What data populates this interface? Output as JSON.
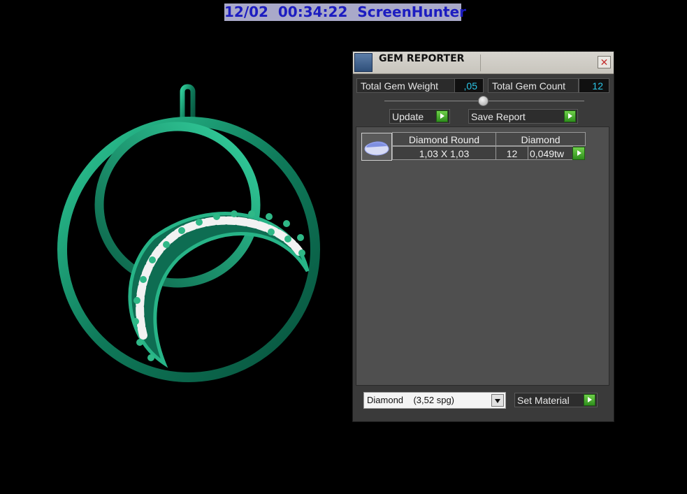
{
  "timestamp_overlay": "12/02  00:34:22  ScreenHunter",
  "viewport": {
    "model_color": "#1a8a68",
    "model_highlight": "#3ad0a2",
    "gem_color": "#f2f2f2"
  },
  "gem_reporter": {
    "title": "GEM REPORTER",
    "close_symbol": "✕",
    "total_weight_label": "Total Gem Weight",
    "total_weight_value": ",05",
    "total_count_label": "Total Gem Count",
    "total_count_value": "12",
    "update_label": "Update",
    "save_report_label": "Save Report",
    "table": {
      "headers": [
        "Diamond Round",
        "Diamond"
      ],
      "rows": [
        {
          "size": "1,03 X 1,03",
          "count": "12",
          "weight": "0,049tw"
        }
      ]
    },
    "material_select_value": "Diamond    (3,52 spg)",
    "set_material_label": "Set Material"
  }
}
